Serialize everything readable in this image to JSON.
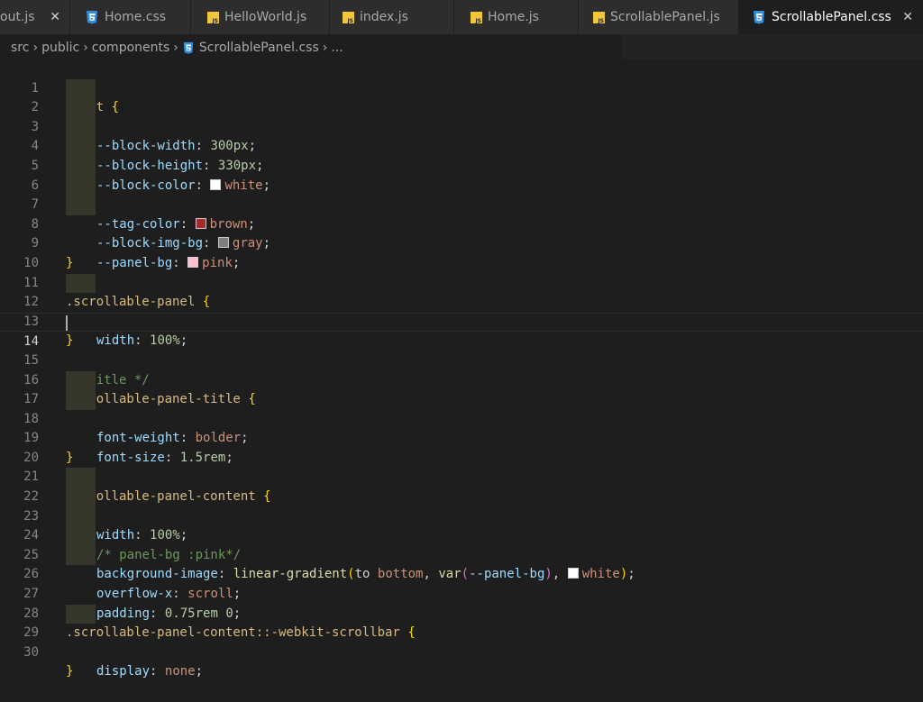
{
  "tabs": [
    {
      "label": "out.js",
      "icon": "js-icon",
      "close": "✕"
    },
    {
      "label": "Home.css",
      "icon": "css-icon"
    },
    {
      "label": "HelloWorld.js",
      "icon": "js-icon"
    },
    {
      "label": "index.js",
      "icon": "js-icon"
    },
    {
      "label": "Home.js",
      "icon": "js-icon"
    },
    {
      "label": "ScrollablePanel.js",
      "icon": "js-icon"
    },
    {
      "label": "ScrollablePanel.css",
      "icon": "css-icon",
      "close": "✕",
      "active": true
    }
  ],
  "breadcrumb": {
    "items": [
      "src",
      "public",
      "components",
      "ScrollablePanel.css",
      "..."
    ],
    "separator": "›"
  },
  "colors": {
    "white": "#ffffff",
    "brown": "#a52a2a",
    "gray": "#808080",
    "pink": "#ffc0cb"
  },
  "editor": {
    "current_line": 14,
    "lines": {
      "l1": {
        "n": "1",
        "selector": ":root",
        "brace": "{"
      },
      "l2": {
        "n": "2",
        "prop": "--block-width",
        "colon": ":",
        "val": "300px",
        "semi": ";"
      },
      "l3": {
        "n": "3",
        "prop": "--block-height",
        "colon": ":",
        "val": "330px",
        "semi": ";"
      },
      "l4": {
        "n": "4",
        "prop": "--block-color",
        "colon": ":",
        "val": "white",
        "semi": ";"
      },
      "l5": {
        "n": "5"
      },
      "l6": {
        "n": "6",
        "prop": "--tag-color",
        "colon": ":",
        "val": "brown",
        "semi": ";"
      },
      "l7": {
        "n": "7",
        "prop": "--block-img-bg",
        "colon": ":",
        "val": "gray",
        "semi": ";"
      },
      "l8": {
        "n": "8",
        "prop": "--panel-bg",
        "colon": ":",
        "val": "pink",
        "semi": ";"
      },
      "l9": {
        "n": "9",
        "brace": "}"
      },
      "l10": {
        "n": "10"
      },
      "l11": {
        "n": "11",
        "selector": ".scrollable-panel",
        "brace": "{"
      },
      "l12": {
        "n": "12",
        "prop": "width",
        "colon": ":",
        "val": "100%",
        "semi": ";"
      },
      "l13": {
        "n": "13",
        "brace": "}"
      },
      "l14": {
        "n": "14"
      },
      "l15": {
        "n": "15",
        "comment": "/* title */"
      },
      "l16": {
        "n": "16",
        "selector": ".scrollable-panel-title",
        "brace": "{"
      },
      "l17": {
        "n": "17",
        "prop": "font-weight",
        "colon": ":",
        "val": "bolder",
        "semi": ";"
      },
      "l18": {
        "n": "18",
        "prop": "font-size",
        "colon": ":",
        "val": "1.5rem",
        "semi": ";"
      },
      "l19": {
        "n": "19",
        "brace": "}"
      },
      "l20": {
        "n": "20"
      },
      "l21": {
        "n": "21",
        "selector": ".scrollable-panel-content",
        "brace": "{"
      },
      "l22": {
        "n": "22",
        "prop": "width",
        "colon": ":",
        "val": "100%",
        "semi": ";"
      },
      "l23": {
        "n": "23",
        "comment": "/* panel-bg :pink*/"
      },
      "l24": {
        "n": "24",
        "prop": "background-image",
        "colon": ":",
        "fn": "linear-gradient",
        "open": "(",
        "kw": "to",
        "dir": "bottom",
        "comma": ",",
        "fn2": "var",
        "open2": "(",
        "arg": "--panel-bg",
        "close2": ")",
        "comma2": ",",
        "val": "white",
        "close": ")",
        "semi": ";"
      },
      "l25": {
        "n": "25",
        "prop": "overflow-x",
        "colon": ":",
        "val": "scroll",
        "semi": ";"
      },
      "l26": {
        "n": "26",
        "prop": "padding",
        "colon": ":",
        "val": "0.75rem 0",
        "semi": ";"
      },
      "l27": {
        "n": "27",
        "brace": "}"
      },
      "l28": {
        "n": "28",
        "selector": ".scrollable-panel-content::-webkit-scrollbar",
        "brace": "{"
      },
      "l29": {
        "n": "29",
        "prop": "display",
        "colon": ":",
        "val": "none",
        "semi": ";"
      },
      "l30": {
        "n": "30",
        "brace": "}"
      }
    }
  }
}
